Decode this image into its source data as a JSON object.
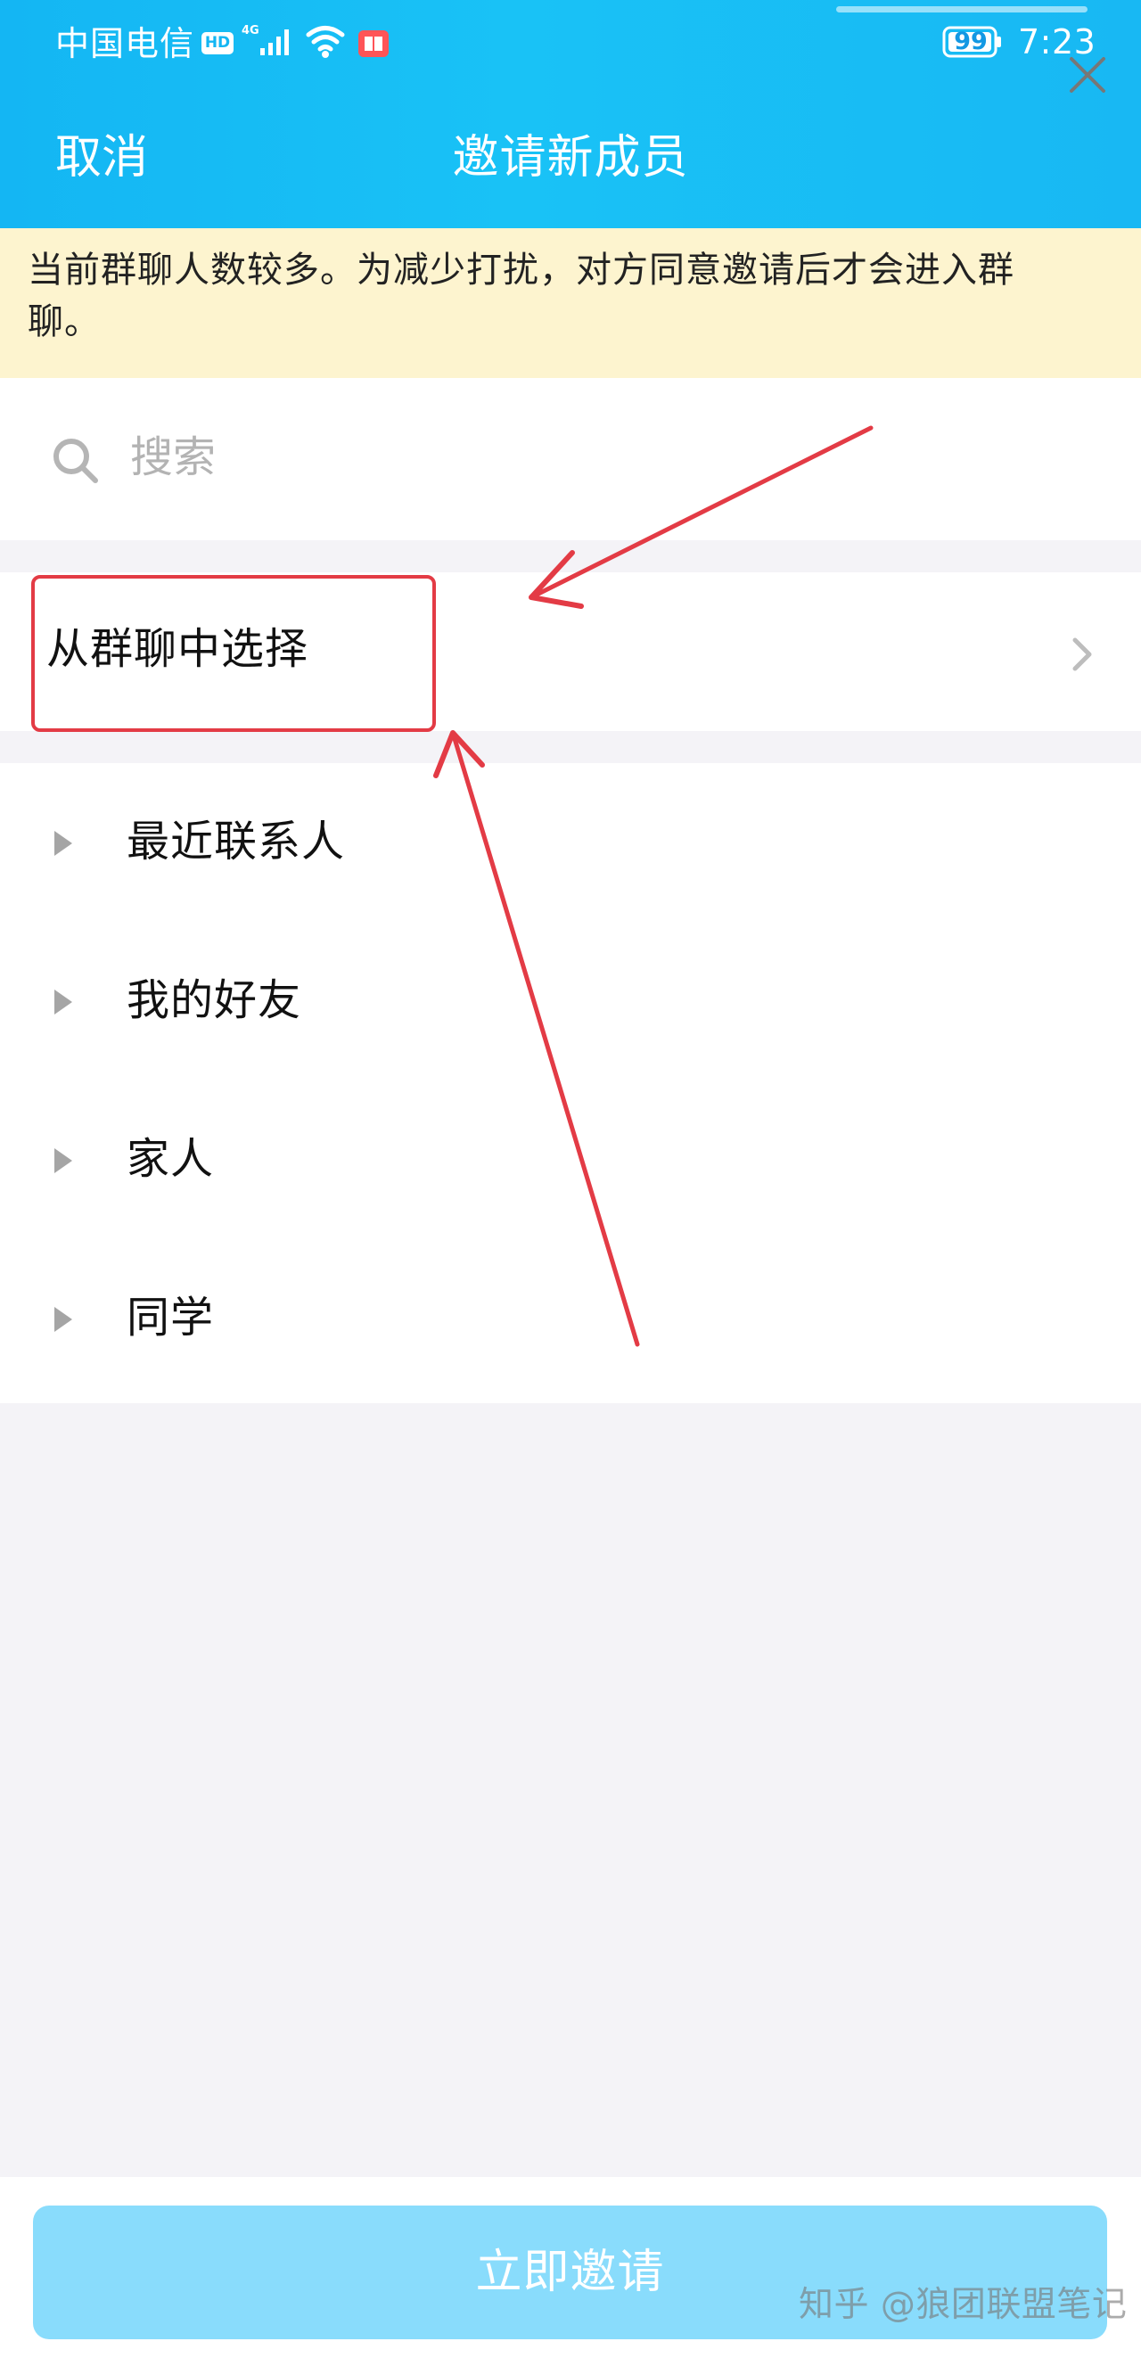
{
  "status_bar": {
    "carrier": "中国电信",
    "hd_badge": "HD",
    "battery_level": "99",
    "time": "7:23"
  },
  "navigation": {
    "cancel_label": "取消",
    "title": "邀请新成员"
  },
  "notice": {
    "text": "当前群聊人数较多。为减少打扰，对方同意邀请后才会进入群聊。"
  },
  "search": {
    "placeholder": "搜索"
  },
  "group_selection": {
    "label": "从群聊中选择"
  },
  "contacts": [
    {
      "label": "最近联系人"
    },
    {
      "label": "我的好友"
    },
    {
      "label": "家人"
    },
    {
      "label": "同学"
    }
  ],
  "footer": {
    "invite_label": "立即邀请",
    "watermark": "知乎 @狼团联盟笔记"
  },
  "colors": {
    "header_blue": "#19c2f6",
    "notice_background": "#fdf4cf",
    "button_blue": "#89dcfc",
    "annotation_red": "#e33b45"
  },
  "icons": {
    "search": "search-icon",
    "close": "close-icon",
    "chevron": "chevron-right-icon",
    "expand": "triangle-right-icon"
  }
}
